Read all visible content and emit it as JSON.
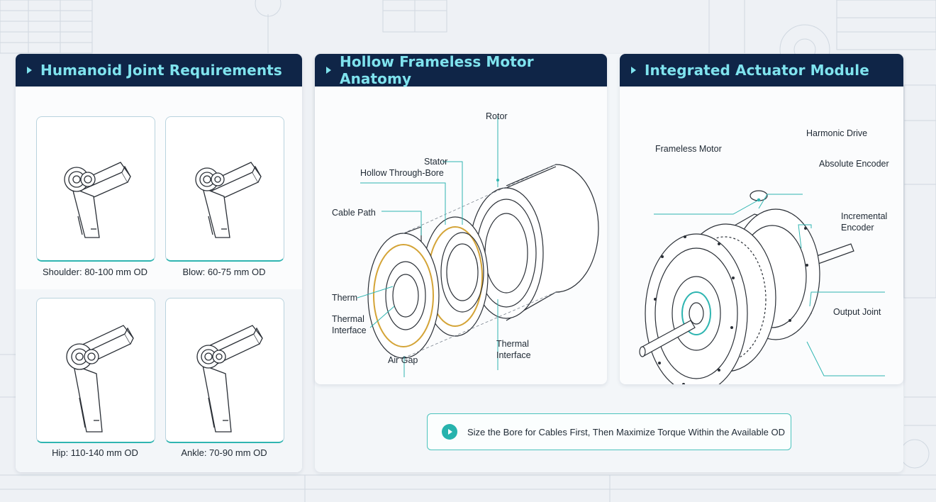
{
  "colors": {
    "header_bg": "#0f2547",
    "header_text": "#7fe3ee",
    "accent": "#2fb5b1"
  },
  "panels": [
    {
      "title": "Humanoid Joint Requirements"
    },
    {
      "title": "Hollow Frameless Motor Anatomy"
    },
    {
      "title": "Integrated Actuator Module"
    }
  ],
  "joints": [
    {
      "caption": "Shoulder: 80-100 mm OD"
    },
    {
      "caption": "Blow: 60-75 mm OD"
    },
    {
      "caption": "Hip: 110-140 mm OD"
    },
    {
      "caption": "Ankle: 70-90 mm OD"
    }
  ],
  "anatomy_labels": {
    "rotor": "Rotor",
    "stator": "Stator",
    "bore": "Hollow Through-Bore",
    "cable": "Cable Path",
    "therm_short": "Therm",
    "thermal_left_1": "Thermal",
    "thermal_left_2": "Interface",
    "air_gap": "Air Gap",
    "thermal_right_1": "Thermal",
    "thermal_right_2": "Interface"
  },
  "actuator_labels": {
    "frameless": "Frameless Motor",
    "harmonic": "Harmonic Drive",
    "abs_encoder": "Absolute Encoder",
    "inc_encoder_1": "Incremental",
    "inc_encoder_2": "Encoder",
    "output": "Output Joint"
  },
  "banner": {
    "text": "Size the Bore for Cables First, Then Maximize Torque Within the Available OD",
    "icon": "play-icon"
  }
}
